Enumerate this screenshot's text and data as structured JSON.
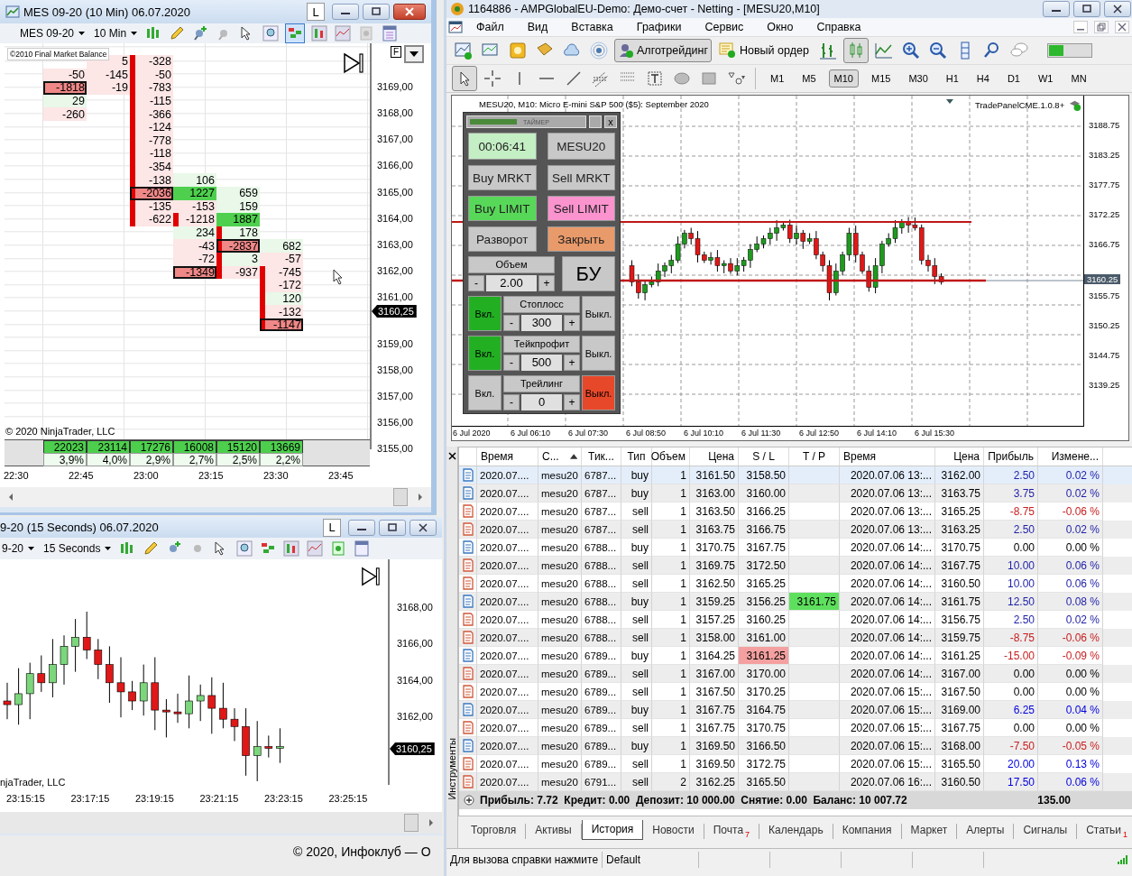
{
  "ninja_main": {
    "title": "MES 09-20 (10 Min)  06.07.2020",
    "l_button": "L",
    "instrument": "MES 09-20",
    "interval": "10 Min",
    "indicator_label": "©2010 Final Market Balance",
    "f_label": "F",
    "footprint": [
      {
        "column_2": {
          "value": "5",
          "positive": false,
          "strong": false,
          "boxed": false,
          "bar": false
        },
        "column_3": {
          "value": "-328",
          "positive": false,
          "strong": false,
          "boxed": false,
          "bar": true
        }
      },
      {
        "column_1": {
          "value": "-50",
          "positive": false,
          "strong": false,
          "boxed": false,
          "bar": false
        },
        "column_2": {
          "value": "-145",
          "positive": false,
          "strong": false,
          "boxed": false,
          "bar": false
        },
        "column_3": {
          "value": "-50",
          "positive": false,
          "strong": false,
          "boxed": false,
          "bar": true
        }
      },
      {
        "column_1": {
          "value": "-1818",
          "positive": false,
          "strong": true,
          "boxed": true,
          "bar": false
        },
        "column_2": {
          "value": "-19",
          "positive": false,
          "strong": false,
          "boxed": false,
          "bar": false
        },
        "column_3": {
          "value": "-783",
          "positive": false,
          "strong": false,
          "boxed": false,
          "bar": true
        }
      },
      {
        "column_1": {
          "value": "29",
          "positive": true,
          "strong": false,
          "boxed": false,
          "bar": false
        },
        "column_3": {
          "value": "-115",
          "positive": false,
          "strong": false,
          "boxed": false,
          "bar": true
        }
      },
      {
        "column_1": {
          "value": "-260",
          "positive": false,
          "strong": false,
          "boxed": false,
          "bar": false
        },
        "column_3": {
          "value": "-366",
          "positive": false,
          "strong": false,
          "boxed": false,
          "bar": true
        }
      },
      {
        "column_3": {
          "value": "-124",
          "positive": false,
          "strong": false,
          "boxed": false,
          "bar": true
        }
      },
      {
        "column_3": {
          "value": "-778",
          "positive": false,
          "strong": false,
          "boxed": false,
          "bar": true
        }
      },
      {
        "column_3": {
          "value": "-118",
          "positive": false,
          "strong": false,
          "boxed": false,
          "bar": true
        }
      },
      {
        "column_3": {
          "value": "-354",
          "positive": false,
          "strong": false,
          "boxed": false,
          "bar": true
        }
      },
      {
        "column_3": {
          "value": "-138",
          "positive": false,
          "strong": false,
          "boxed": false,
          "bar": true
        },
        "column_4": {
          "value": "106",
          "positive": true,
          "strong": false,
          "boxed": false,
          "bar": false
        }
      },
      {
        "column_3": {
          "value": "-2036",
          "positive": false,
          "strong": true,
          "boxed": true,
          "bar": true
        },
        "column_4": {
          "value": "1227",
          "positive": true,
          "strong": true,
          "boxed": false,
          "bar": false
        },
        "column_5": {
          "value": "659",
          "positive": true,
          "strong": false,
          "boxed": false,
          "bar": false
        }
      },
      {
        "column_3": {
          "value": "-135",
          "positive": false,
          "strong": false,
          "boxed": false,
          "bar": true
        },
        "column_4": {
          "value": "-153",
          "positive": false,
          "strong": false,
          "boxed": false,
          "bar": false
        },
        "column_5": {
          "value": "159",
          "positive": true,
          "strong": false,
          "boxed": false,
          "bar": false
        }
      },
      {
        "column_3": {
          "value": "-622",
          "positive": false,
          "strong": false,
          "boxed": false,
          "bar": true
        },
        "column_4": {
          "value": "-1218",
          "positive": false,
          "strong": false,
          "boxed": false,
          "bar": true
        },
        "column_5": {
          "value": "1887",
          "positive": true,
          "strong": true,
          "boxed": false,
          "bar": false
        }
      },
      {
        "column_4": {
          "value": "234",
          "positive": true,
          "strong": false,
          "boxed": false,
          "bar": false
        },
        "column_5": {
          "value": "178",
          "positive": true,
          "strong": false,
          "boxed": false,
          "bar": true
        }
      },
      {
        "column_4": {
          "value": "-43",
          "positive": false,
          "strong": false,
          "boxed": false,
          "bar": false
        },
        "column_5": {
          "value": "-2837",
          "positive": false,
          "strong": true,
          "boxed": true,
          "bar": true
        },
        "column_6": {
          "value": "682",
          "positive": true,
          "strong": false,
          "boxed": false,
          "bar": false
        }
      },
      {
        "column_4": {
          "value": "-72",
          "positive": false,
          "strong": false,
          "boxed": false,
          "bar": false
        },
        "column_5": {
          "value": "3",
          "positive": true,
          "strong": false,
          "boxed": false,
          "bar": true
        },
        "column_6": {
          "value": "-57",
          "positive": false,
          "strong": false,
          "boxed": false,
          "bar": false
        }
      },
      {
        "column_4": {
          "value": "-1349",
          "positive": false,
          "strong": true,
          "boxed": true,
          "bar": false
        },
        "column_5": {
          "value": "-937",
          "positive": false,
          "strong": false,
          "boxed": false,
          "bar": true
        },
        "column_6": {
          "value": "-745",
          "positive": false,
          "strong": false,
          "boxed": false,
          "bar": true
        }
      },
      {
        "column_6": {
          "value": "-172",
          "positive": false,
          "strong": false,
          "boxed": false,
          "bar": true
        }
      },
      {
        "column_6": {
          "value": "120",
          "positive": true,
          "strong": false,
          "boxed": false,
          "bar": true
        }
      },
      {
        "column_6": {
          "value": "-132",
          "positive": false,
          "strong": false,
          "boxed": false,
          "bar": true
        }
      },
      {
        "column_6": {
          "value": "-1147",
          "positive": false,
          "strong": true,
          "boxed": true,
          "bar": true
        }
      }
    ],
    "volumes": [
      "22023",
      "23114",
      "17276",
      "16008",
      "15120",
      "13669"
    ],
    "percents": [
      "3,9%",
      "4,0%",
      "2,9%",
      "2,7%",
      "2,5%",
      "2,2%"
    ],
    "copyright": "© 2020 NinjaTrader, LLC",
    "price_axis": [
      "3169,00",
      "3168,00",
      "3167,00",
      "3166,00",
      "3165,00",
      "3164,00",
      "3163,00",
      "3162,00",
      "3161,00",
      "3160,25",
      "3159,00",
      "3158,00",
      "3157,00",
      "3156,00",
      "3155,00"
    ],
    "time_axis": [
      "22:30",
      "22:45",
      "23:00",
      "23:15",
      "23:30",
      "23:45"
    ]
  },
  "ninja_second": {
    "title": "9-20 (15 Seconds)  06.07.2020",
    "l_button": "L",
    "instrument": "9-20",
    "interval": "15 Seconds",
    "copyright": "njaTrader, LLC",
    "price_axis": [
      "3168,00",
      "3166,00",
      "3164,00",
      "3162,00"
    ],
    "price_tag": "3160,25",
    "time_axis": [
      "23:15:15",
      "23:17:15",
      "23:19:15",
      "23:21:15",
      "23:23:15",
      "23:25:15"
    ]
  },
  "footer": "© 2020, Инфоклуб — О",
  "metatrader": {
    "title": "1164886 - AMPGlobalEU-Demo: Демо-счет - Netting - [MESU20,M10]",
    "menu": [
      "Файл",
      "Вид",
      "Вставка",
      "Графики",
      "Сервис",
      "Окно",
      "Справка"
    ],
    "algo_button": "Алготрейдинг",
    "algo_on": true,
    "new_order": "Новый ордер",
    "timeframes": [
      {
        "label": "M1",
        "selected": false
      },
      {
        "label": "M5",
        "selected": false
      },
      {
        "label": "M10",
        "selected": true
      },
      {
        "label": "M15",
        "selected": false
      },
      {
        "label": "M30",
        "selected": false
      },
      {
        "label": "H1",
        "selected": false
      },
      {
        "label": "H4",
        "selected": false
      },
      {
        "label": "D1",
        "selected": false
      },
      {
        "label": "W1",
        "selected": false
      },
      {
        "label": "MN",
        "selected": false
      }
    ],
    "chart_title": "MESU20, M10:  Micro E-mini S&P 500 ($5): September 2020",
    "expert": "TradePanelCME.1.0.8+",
    "price_axis": [
      "3188.75",
      "3183.25",
      "3177.75",
      "3172.25",
      "3166.75",
      "3160.25",
      "3155.75",
      "3150.25",
      "3144.75",
      "3139.25"
    ],
    "time_axis": [
      "6 Jul 2020",
      "6 Jul 06:10",
      "6 Jul 07:30",
      "6 Jul 08:50",
      "6 Jul 10:10",
      "6 Jul 11:30",
      "6 Jul 12:50",
      "6 Jul 14:10",
      "6 Jul 15:30"
    ],
    "panel": {
      "timer_label": "ТАЙМЕР",
      "timer": {
        "level": 0.4
      },
      "close": "x",
      "time": "00:06:41",
      "symbol": "MESU20",
      "buttons": [
        {
          "label": "Buy MRKT",
          "kind": "plain"
        },
        {
          "label": "Sell MRKT",
          "kind": "plain"
        },
        {
          "label": "Buy LIMIT",
          "kind": "buy"
        },
        {
          "label": "Sell LIMIT",
          "kind": "sell"
        },
        {
          "label": "Разворот",
          "kind": "plain"
        },
        {
          "label": "Закрыть",
          "kind": "close"
        }
      ],
      "volume_label": "Объем",
      "minus": "-",
      "plus": "+",
      "volume": "2.00",
      "breakeven": "БУ",
      "stops": [
        {
          "label": "Стоплосс",
          "value": "300",
          "on_label": "Вкл.",
          "off_label": "Выкл.",
          "enabled": true
        },
        {
          "label": "Тейкпрофит",
          "value": "500",
          "on_label": "Вкл.",
          "off_label": "Выкл.",
          "enabled": true
        },
        {
          "label": "Трейлинг",
          "value": "0",
          "on_label": "Вкл.",
          "off_label": "Выкл.",
          "enabled": false
        }
      ]
    },
    "columns": [
      {
        "label": "Время",
        "sorted": false
      },
      {
        "label": "С...",
        "sorted": true
      },
      {
        "label": "Тик...",
        "sorted": false
      },
      {
        "label": "Тип",
        "sorted": false
      },
      {
        "label": "Объем",
        "sorted": false
      },
      {
        "label": "Цена",
        "sorted": false
      },
      {
        "label": "S / L",
        "sorted": false
      },
      {
        "label": "T / P",
        "sorted": false
      },
      {
        "label": "Время",
        "sorted": false
      },
      {
        "label": "Цена",
        "sorted": false
      },
      {
        "label": "Прибыль",
        "sorted": false
      },
      {
        "label": "Измене...",
        "sorted": false
      }
    ],
    "rows": [
      {
        "open": "2020.07....",
        "symbol": "mesu20",
        "ticket": "6787...",
        "type": "buy",
        "kind": "buy",
        "volume": "1",
        "price": "3161.50",
        "sl": "3158.50",
        "close": "2020.07.06 13:...",
        "close_price": "3162.00",
        "profit": "2.50",
        "change": "0.02 %",
        "color": "#1f1fa8",
        "selected": true,
        "sl_hit": false
      },
      {
        "open": "2020.07....",
        "symbol": "mesu20",
        "ticket": "6787...",
        "type": "buy",
        "kind": "buy",
        "volume": "1",
        "price": "3163.00",
        "sl": "3160.00",
        "close": "2020.07.06 13:...",
        "close_price": "3163.75",
        "profit": "3.75",
        "change": "0.02 %",
        "color": "#1f1fa8",
        "selected": false,
        "sl_hit": false
      },
      {
        "open": "2020.07....",
        "symbol": "mesu20",
        "ticket": "6787...",
        "type": "sell",
        "kind": "sell",
        "volume": "1",
        "price": "3163.50",
        "sl": "3166.25",
        "close": "2020.07.06 13:...",
        "close_price": "3165.25",
        "profit": "-8.75",
        "change": "-0.06 %",
        "color": "#c81e1e",
        "selected": false,
        "sl_hit": false
      },
      {
        "open": "2020.07....",
        "symbol": "mesu20",
        "ticket": "6787...",
        "type": "sell",
        "kind": "sell",
        "volume": "1",
        "price": "3163.75",
        "sl": "3166.75",
        "close": "2020.07.06 13:...",
        "close_price": "3163.25",
        "profit": "2.50",
        "change": "0.02 %",
        "color": "#1f1fa8",
        "selected": false,
        "sl_hit": false
      },
      {
        "open": "2020.07....",
        "symbol": "mesu20",
        "ticket": "6788...",
        "type": "buy",
        "kind": "buy",
        "volume": "1",
        "price": "3170.75",
        "sl": "3167.75",
        "close": "2020.07.06 14:...",
        "close_price": "3170.75",
        "profit": "0.00",
        "change": "0.00 %",
        "selected": false,
        "sl_hit": false
      },
      {
        "open": "2020.07....",
        "symbol": "mesu20",
        "ticket": "6788...",
        "type": "sell",
        "kind": "sell",
        "volume": "1",
        "price": "3169.75",
        "sl": "3172.50",
        "close": "2020.07.06 14:...",
        "close_price": "3167.75",
        "profit": "10.00",
        "change": "0.06 %",
        "color": "#1f1fa8",
        "selected": false,
        "sl_hit": false
      },
      {
        "open": "2020.07....",
        "symbol": "mesu20",
        "ticket": "6788...",
        "type": "sell",
        "kind": "sell",
        "volume": "1",
        "price": "3162.50",
        "sl": "3165.25",
        "close": "2020.07.06 14:...",
        "close_price": "3160.50",
        "profit": "10.00",
        "change": "0.06 %",
        "color": "#1f1fa8",
        "selected": false,
        "sl_hit": false
      },
      {
        "open": "2020.07....",
        "symbol": "mesu20",
        "ticket": "6788...",
        "type": "buy",
        "kind": "buy",
        "volume": "1",
        "price": "3159.25",
        "sl": "3156.25",
        "tp": "3161.75",
        "tp_hit": true,
        "close": "2020.07.06 14:...",
        "close_price": "3161.75",
        "profit": "12.50",
        "change": "0.08 %",
        "color": "#1f1fa8",
        "selected": false,
        "sl_hit": false
      },
      {
        "open": "2020.07....",
        "symbol": "mesu20",
        "ticket": "6788...",
        "type": "sell",
        "kind": "sell",
        "volume": "1",
        "price": "3157.25",
        "sl": "3160.25",
        "close": "2020.07.06 14:...",
        "close_price": "3156.75",
        "profit": "2.50",
        "change": "0.02 %",
        "color": "#1f1fa8",
        "selected": false,
        "sl_hit": false
      },
      {
        "open": "2020.07....",
        "symbol": "mesu20",
        "ticket": "6788...",
        "type": "sell",
        "kind": "sell",
        "volume": "1",
        "price": "3158.00",
        "sl": "3161.00",
        "close": "2020.07.06 14:...",
        "close_price": "3159.75",
        "profit": "-8.75",
        "change": "-0.06 %",
        "color": "#c81e1e",
        "selected": false,
        "sl_hit": false
      },
      {
        "open": "2020.07....",
        "symbol": "mesu20",
        "ticket": "6789...",
        "type": "buy",
        "kind": "buy",
        "volume": "1",
        "price": "3164.25",
        "sl": "3161.25",
        "close": "2020.07.06 14:...",
        "close_price": "3161.25",
        "profit": "-15.00",
        "change": "-0.09 %",
        "color": "#c81e1e",
        "selected": false,
        "sl_hit": true
      },
      {
        "open": "2020.07....",
        "symbol": "mesu20",
        "ticket": "6789...",
        "type": "sell",
        "kind": "sell",
        "volume": "1",
        "price": "3167.00",
        "sl": "3170.00",
        "close": "2020.07.06 14:...",
        "close_price": "3167.00",
        "profit": "0.00",
        "change": "0.00 %",
        "selected": false,
        "sl_hit": false
      },
      {
        "open": "2020.07....",
        "symbol": "mesu20",
        "ticket": "6789...",
        "type": "sell",
        "kind": "sell",
        "volume": "1",
        "price": "3167.50",
        "sl": "3170.25",
        "close": "2020.07.06 15:...",
        "close_price": "3167.50",
        "profit": "0.00",
        "change": "0.00 %",
        "selected": false,
        "sl_hit": false
      },
      {
        "open": "2020.07....",
        "symbol": "mesu20",
        "ticket": "6789...",
        "type": "buy",
        "kind": "buy",
        "volume": "1",
        "price": "3167.75",
        "sl": "3164.75",
        "close": "2020.07.06 15:...",
        "close_price": "3169.00",
        "profit": "6.25",
        "change": "0.04 %",
        "color": "#0000e0",
        "selected": false,
        "sl_hit": false
      },
      {
        "open": "2020.07....",
        "symbol": "mesu20",
        "ticket": "6789...",
        "type": "sell",
        "kind": "sell",
        "volume": "1",
        "price": "3167.75",
        "sl": "3170.75",
        "close": "2020.07.06 15:...",
        "close_price": "3167.75",
        "profit": "0.00",
        "change": "0.00 %",
        "selected": false,
        "sl_hit": false
      },
      {
        "open": "2020.07....",
        "symbol": "mesu20",
        "ticket": "6789...",
        "type": "buy",
        "kind": "buy",
        "volume": "1",
        "price": "3169.50",
        "sl": "3166.50",
        "close": "2020.07.06 15:...",
        "close_price": "3168.00",
        "profit": "-7.50",
        "change": "-0.05 %",
        "color": "#c81e1e",
        "selected": false,
        "sl_hit": false
      },
      {
        "open": "2020.07....",
        "symbol": "mesu20",
        "ticket": "6789...",
        "type": "sell",
        "kind": "sell",
        "volume": "1",
        "price": "3169.50",
        "sl": "3172.75",
        "close": "2020.07.06 15:...",
        "close_price": "3165.50",
        "profit": "20.00",
        "change": "0.13 %",
        "color": "#0000e0",
        "selected": false,
        "sl_hit": false
      },
      {
        "open": "2020.07....",
        "symbol": "mesu20",
        "ticket": "6791...",
        "type": "sell",
        "kind": "sell",
        "volume": "2",
        "price": "3162.25",
        "sl": "3165.50",
        "close": "2020.07.06 16:...",
        "close_price": "3160.50",
        "profit": "17.50",
        "change": "0.06 %",
        "color": "#0000e0",
        "selected": false,
        "sl_hit": false
      }
    ],
    "summary": "Прибыль: 7.72  Кредит: 0.00  Депозит: 10 000.00  Снятие: 0.00  Баланс: 10 007.72",
    "summary_total": "135.00",
    "side_label": "Инструменты",
    "tabs": [
      {
        "label": "Торговля",
        "selected": false
      },
      {
        "label": "Активы",
        "selected": false
      },
      {
        "label": "История",
        "selected": true
      },
      {
        "label": "Новости",
        "selected": false
      },
      {
        "label": "Почта",
        "badge": "7",
        "selected": false
      },
      {
        "label": "Календарь",
        "selected": false
      },
      {
        "label": "Компания",
        "selected": false
      },
      {
        "label": "Маркет",
        "selected": false
      },
      {
        "label": "Алерты",
        "selected": false
      },
      {
        "label": "Сигналы",
        "selected": false
      },
      {
        "label": "Статьи",
        "badge": "1",
        "selected": false
      }
    ],
    "status": [
      "Для вызова справки нажмите",
      "Default"
    ]
  }
}
